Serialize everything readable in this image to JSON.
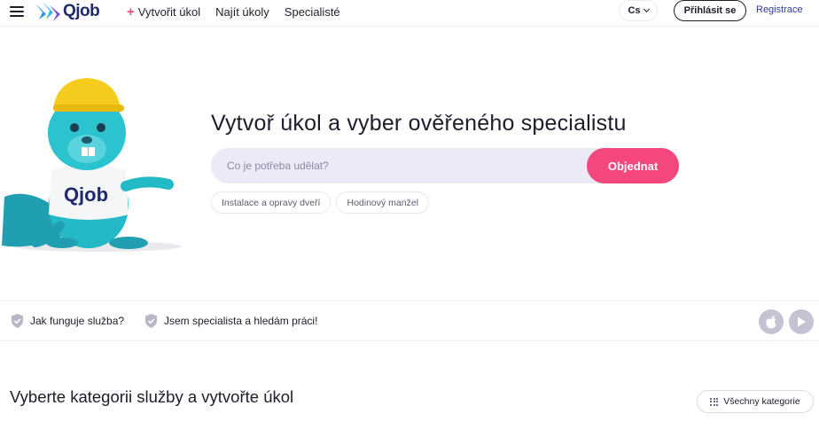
{
  "header": {
    "logo_text": "Qjob",
    "nav": [
      {
        "label": "Vytvořit úkol",
        "plus": "+"
      },
      {
        "label": "Najít úkoly"
      },
      {
        "label": "Specialisté"
      }
    ],
    "language": "Cs",
    "login_label": "Přihlásit se",
    "register_label": "Registrace"
  },
  "hero": {
    "title": "Vytvoř úkol a vyber ověřeného specialistu",
    "search_placeholder": "Co je potřeba udělat?",
    "order_label": "Objednat",
    "chips": [
      "Instalace a opravy dveří",
      "Hodinový manžel"
    ],
    "mascot_shirt_text": "Qjob"
  },
  "strip": {
    "how_it_works": "Jak funguje služba?",
    "specialist_job": "Jsem specialista a hledám práci!"
  },
  "categories": {
    "title": "Vyberte kategorii služby a vytvořte úkol",
    "all_label": "Všechny kategorie"
  },
  "colors": {
    "accent": "#f4477d",
    "brand": "#1f2a6b",
    "mascot": "#23b9c6",
    "helmet": "#f5cc1e"
  }
}
